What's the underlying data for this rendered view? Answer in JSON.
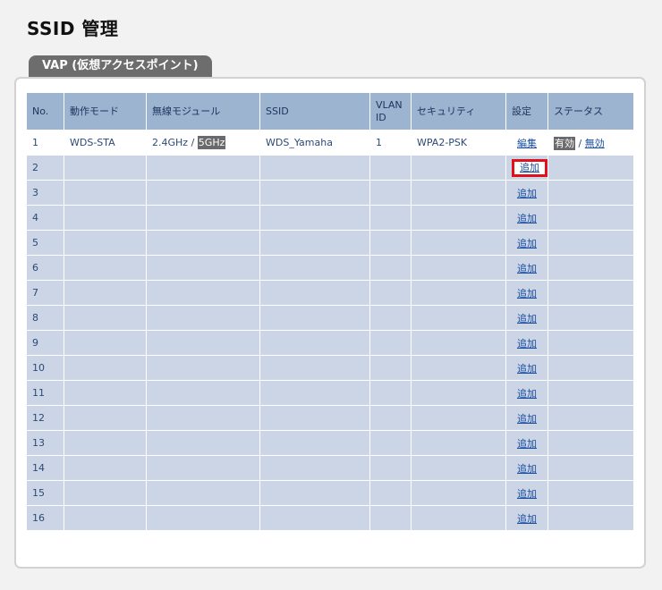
{
  "page": {
    "title": "SSID 管理",
    "tab": "VAP (仮想アクセスポイント)"
  },
  "table": {
    "headers": {
      "no": "No.",
      "mode": "動作モード",
      "module": "無線モジュール",
      "ssid": "SSID",
      "vlan": "VLAN ID",
      "security": "セキュリティ",
      "settings": "設定",
      "status": "ステータス"
    },
    "configured_row": {
      "no": "1",
      "mode": "WDS-STA",
      "module_a": "2.4GHz",
      "module_sep": "/",
      "module_b": "5GHz",
      "ssid": "WDS_Yamaha",
      "vlan": "1",
      "security": "WPA2-PSK",
      "edit_link": "編集",
      "status_enabled": "有効",
      "status_sep": "/",
      "status_disabled": "無効"
    },
    "empty_rows": [
      {
        "no": "2",
        "action": "追加"
      },
      {
        "no": "3",
        "action": "追加"
      },
      {
        "no": "4",
        "action": "追加"
      },
      {
        "no": "5",
        "action": "追加"
      },
      {
        "no": "6",
        "action": "追加"
      },
      {
        "no": "7",
        "action": "追加"
      },
      {
        "no": "8",
        "action": "追加"
      },
      {
        "no": "9",
        "action": "追加"
      },
      {
        "no": "10",
        "action": "追加"
      },
      {
        "no": "11",
        "action": "追加"
      },
      {
        "no": "12",
        "action": "追加"
      },
      {
        "no": "13",
        "action": "追加"
      },
      {
        "no": "14",
        "action": "追加"
      },
      {
        "no": "15",
        "action": "追加"
      },
      {
        "no": "16",
        "action": "追加"
      }
    ]
  },
  "colors": {
    "header_bg": "#9cb4d0",
    "row_bg": "#cbd5e6",
    "highlight_border": "#e0101c",
    "tab_bg": "#6d6d6d"
  }
}
